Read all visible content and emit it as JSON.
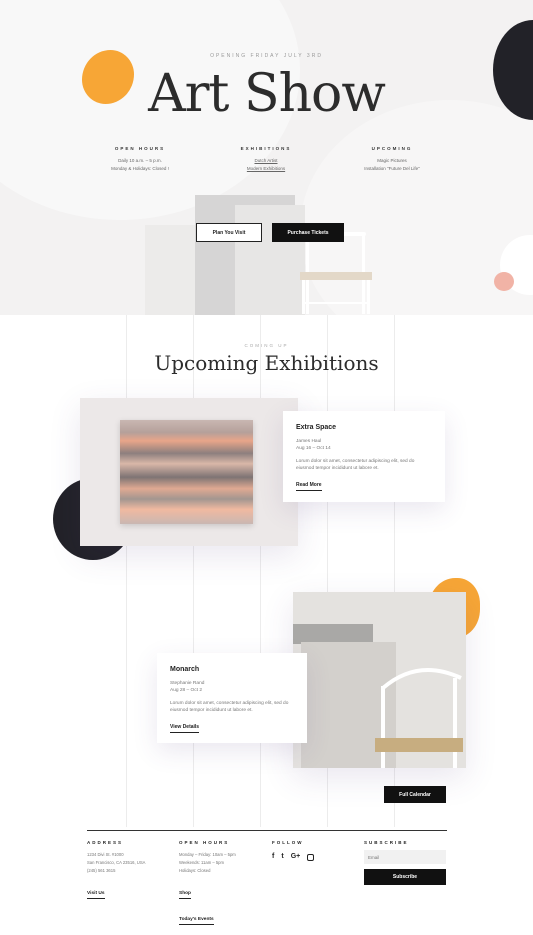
{
  "hero": {
    "tagline": "OPENING FRIDAY JULY 3RD",
    "title": "Art Show",
    "columns": [
      {
        "heading": "OPEN HOURS",
        "lines": [
          "Daily 10 a.m. – 5 p.m.",
          "Monday & Holidays: Closed !"
        ]
      },
      {
        "heading": "EXHIBITIONS",
        "lines": [
          "Dutch Artist",
          "Modern Exhibitions"
        ]
      },
      {
        "heading": "UPCOMING",
        "lines": [
          "Magic Pictures",
          "Installation \"Future Del Life\""
        ]
      }
    ],
    "btn_visit": "Plan You Visit",
    "btn_tickets": "Purchase Tickets"
  },
  "upcoming": {
    "eyebrow": "COMING UP",
    "title": "Upcoming Exhibitions",
    "exhibits": [
      {
        "title": "Extra Space",
        "artist": "James Haul",
        "dates": "Aug 16 – Oct 14",
        "desc": "Lorum dolor sit amet, consectetur adipiscing elit, sed do eiusmod tempor incididunt ut labore et.",
        "link": "Read More"
      },
      {
        "title": "Monarch",
        "artist": "Stephanie Rand",
        "dates": "Aug 28 – Oct 2",
        "desc": "Lorum dolor sit amet, consectetur adipiscing elit, sed do eiusmod tempor incididunt ut labore et.",
        "link": "View Details"
      }
    ],
    "calendar_btn": "Full Calendar"
  },
  "footer": {
    "address": {
      "heading": "ADDRESS",
      "lines": [
        "1234 Divi St. #1000",
        "San Francisco, CA 23516, USA",
        "(245) 561 3615"
      ],
      "link": "Visit Us"
    },
    "hours": {
      "heading": "OPEN HOURS",
      "lines": [
        "Monday – Friday: 10am – 5pm",
        "Weekends: 11am – 5pm",
        "Holidays: Closed"
      ],
      "link1": "Shop",
      "link2": "Today's Events"
    },
    "follow": {
      "heading": "FOLLOW",
      "icons": [
        "f",
        "t",
        "G+",
        "ig"
      ]
    },
    "subscribe": {
      "heading": "SUBSCRIBE",
      "placeholder": "Email",
      "button": "Subscribe"
    }
  },
  "colors": {
    "accent_orange": "#f7a636",
    "dark": "#222228",
    "blush": "#f1b3a6"
  }
}
